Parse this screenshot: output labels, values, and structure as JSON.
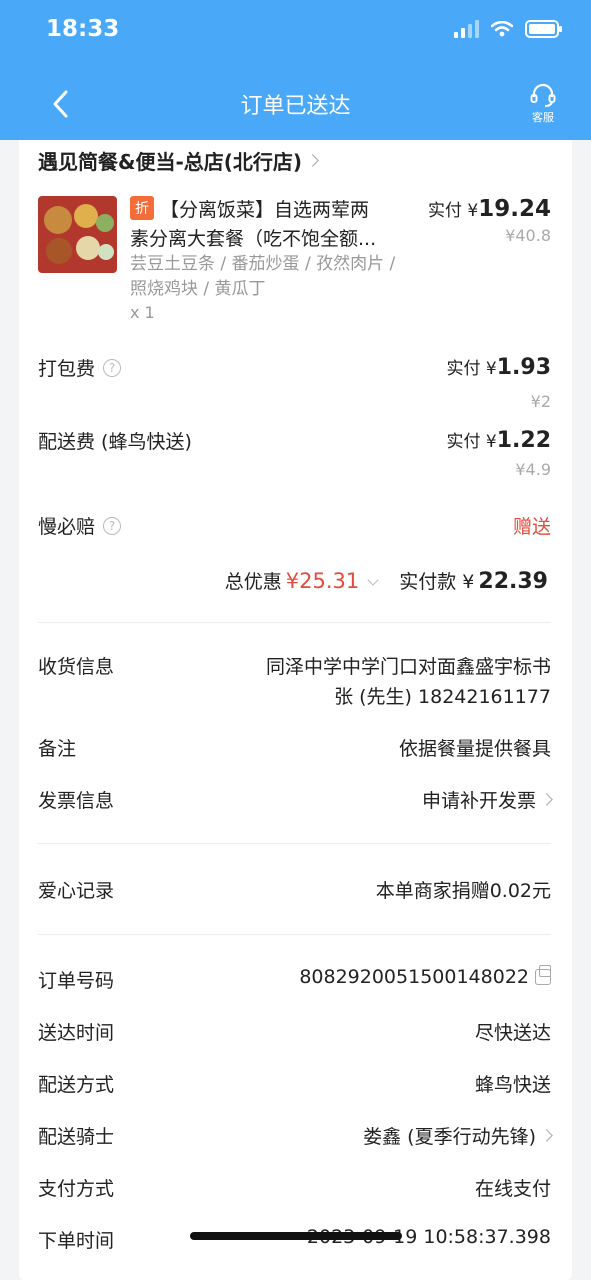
{
  "status_bar": {
    "time": "18:33"
  },
  "nav": {
    "title": "订单已送达",
    "service_label": "客服"
  },
  "shop": {
    "name": "遇见简餐&便当-总店(北行店)"
  },
  "item": {
    "badge": "折",
    "title_line1": "【分离饭菜】自选两荤两",
    "title_line2": "素分离大套餐（吃不饱全额...",
    "specs": "芸豆土豆条 / 番茄炒蛋 / 孜然肉片 / 照烧鸡块 / 黄瓜丁",
    "quantity": "x 1",
    "paid_prefix": "实付 ¥",
    "paid_amount": "19.24",
    "original_price": "¥40.8"
  },
  "fees": [
    {
      "label": "打包费",
      "paid_prefix": "实付 ¥",
      "paid": "1.93",
      "original": "¥2"
    },
    {
      "label": "配送费 (蜂鸟快送)",
      "paid_prefix": "实付 ¥",
      "paid": "1.22",
      "original": "¥4.9"
    }
  ],
  "guarantee": {
    "label": "慢必赔",
    "value": "赠送"
  },
  "summary": {
    "discount_label": "总优惠",
    "discount_value": "¥25.31",
    "paid_label": "实付款 ¥",
    "paid_value": "22.39"
  },
  "delivery_info": {
    "label": "收货信息",
    "address": "同泽中学中学门口对面鑫盛宇标书",
    "contact": "张 (先生) 18242161177"
  },
  "note": {
    "label": "备注",
    "value": "依据餐量提供餐具"
  },
  "invoice": {
    "label": "发票信息",
    "value": "申请补开发票"
  },
  "charity": {
    "label": "爱心记录",
    "value": "本单商家捐赠0.02元"
  },
  "order": {
    "id_label": "订单号码",
    "id_value": "8082920051500148022",
    "delivery_time_label": "送达时间",
    "delivery_time_value": "尽快送达",
    "method_label": "配送方式",
    "method_value": "蜂鸟快送",
    "rider_label": "配送骑士",
    "rider_value": "娄鑫 (夏季行动先锋)",
    "payment_label": "支付方式",
    "payment_value": "在线支付",
    "time_label": "下单时间",
    "time_value": "2023-09-19 10:58:37.398"
  },
  "colors": {
    "header_blue": "#4aa8f8",
    "accent_red": "#e24c3d",
    "badge_orange": "#f36c3a"
  }
}
